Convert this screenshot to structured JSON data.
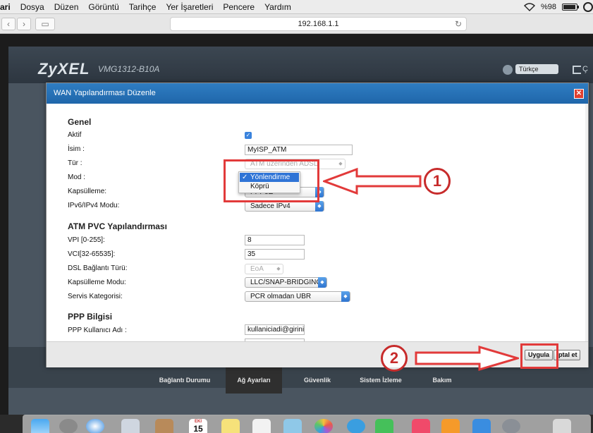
{
  "menubar": {
    "app": "ari",
    "items": [
      "Dosya",
      "Düzen",
      "Görüntü",
      "Tarihçe",
      "Yer İşaretleri",
      "Pencere",
      "Yardım"
    ],
    "battery": "%98"
  },
  "browser": {
    "url": "192.168.1.1"
  },
  "router": {
    "brand": "ZyXEL",
    "model": "VMG1312-B10A",
    "language": "Türkçe",
    "exit_label": "Ç",
    "nav": [
      "Bağlantı Durumu",
      "Ağ Ayarları",
      "Güvenlik",
      "Sistem İzleme",
      "Bakım"
    ]
  },
  "modal": {
    "title": "WAN Yapılandırması Düzenle",
    "close": "✕",
    "general": {
      "heading": "Genel",
      "aktif_label": "Aktif",
      "isim_label": "İsim :",
      "isim_value": "MyISP_ATM",
      "tur_label": "Tür :",
      "tur_value": "ATM üzerinden ADSL",
      "mod_label": "Mod :",
      "kapsulleme_label": "Kapsülleme:",
      "kapsulleme_value": "PPPoE",
      "ipv_label": "IPv6/IPv4 Modu:",
      "ipv_value": "Sadece IPv4"
    },
    "mode_dropdown": {
      "options": [
        "Yönlendirme",
        "Köprü"
      ],
      "selected": "Yönlendirme",
      "check": "✓"
    },
    "atm": {
      "heading": "ATM PVC Yapılandırması",
      "vpi_label": "VPI [0-255]:",
      "vpi_value": "8",
      "vci_label": "VCI[32-65535]:",
      "vci_value": "35",
      "dsl_label": "DSL Bağlantı Türü:",
      "dsl_value": "EoA",
      "kaps_mod_label": "Kapsülleme Modu:",
      "kaps_mod_value": "LLC/SNAP-BRIDGING",
      "servis_label": "Servis Kategorisi:",
      "servis_value": "PCR olmadan UBR"
    },
    "ppp": {
      "heading": "PPP Bilgisi",
      "user_label": "PPP Kullanıcı Adı :",
      "user_value": "kullaniciadi@giriniz"
    },
    "footer": {
      "apply": "Uygula",
      "cancel": "İptal et"
    }
  },
  "annotations": {
    "step1": "1",
    "step2": "2",
    "accent": "#e23a3a"
  },
  "dock": {
    "calendar_month": "EKİ",
    "calendar_day": "15"
  }
}
